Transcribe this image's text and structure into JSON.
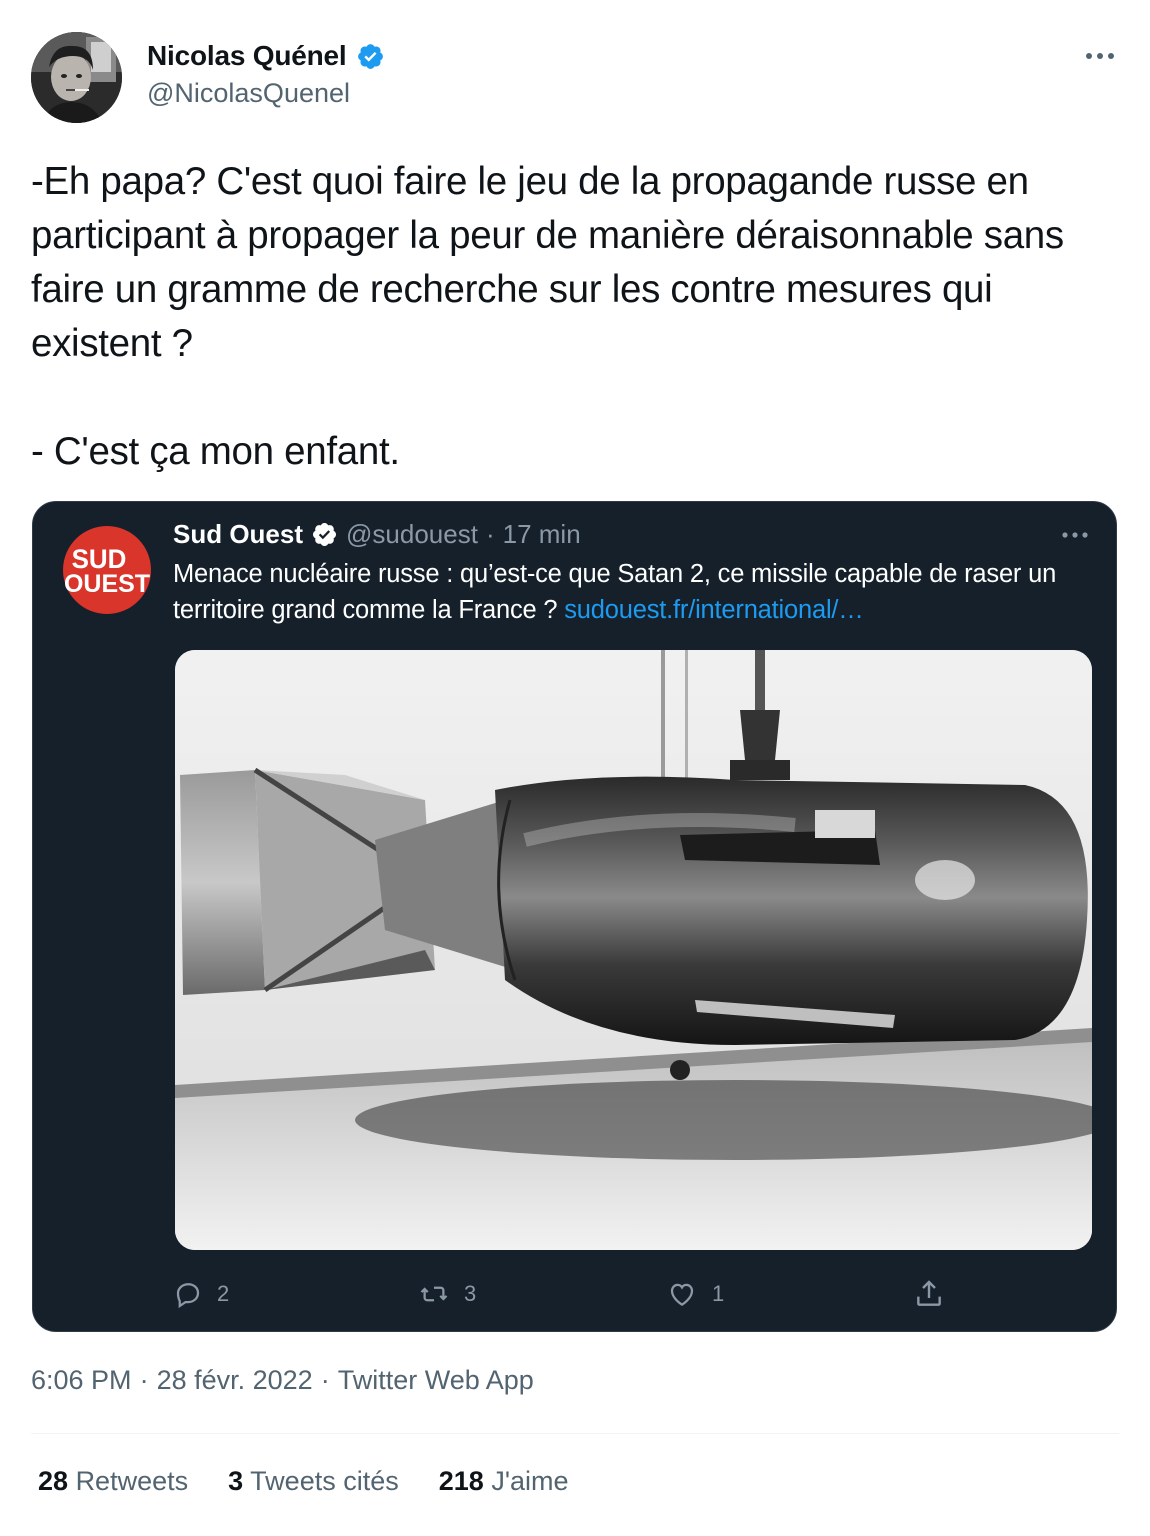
{
  "author": {
    "name": "Nicolas Quénel",
    "handle": "@NicolasQuenel",
    "verified": true
  },
  "tweet": {
    "paragraphs": [
      "-Eh papa? C'est quoi faire le jeu de la propagande russe en participant à propager la peur de manière déraisonnable sans faire un gramme de recherche sur les contre mesures qui existent ?",
      "- C'est ça mon enfant."
    ]
  },
  "quoted": {
    "name": "Sud Ouest",
    "handle": "@sudouest",
    "separator": "·",
    "time": "17 min",
    "text": "Menace nucléaire russe : qu’est-ce que Satan 2, ce missile capable de raser un territoire grand comme la France ?",
    "link": "sudouest.fr/international/…",
    "logo_text_top": "SUD",
    "logo_text_bottom": "OUEST",
    "actions": {
      "replies": "2",
      "retweets": "3",
      "likes": "1"
    }
  },
  "meta": {
    "time": "6:06 PM",
    "sep1": "·",
    "date": "28 févr. 2022",
    "sep2": "·",
    "source": "Twitter Web App"
  },
  "stats": {
    "retweets_count": "28",
    "retweets_label": "Retweets",
    "quotes_count": "3",
    "quotes_label": "Tweets cités",
    "likes_count": "218",
    "likes_label": "J'aime"
  },
  "colors": {
    "accent": "#1d9bf0",
    "card_bg": "#15202b",
    "logo_red": "#d9352b",
    "secondary_text": "#536471"
  }
}
